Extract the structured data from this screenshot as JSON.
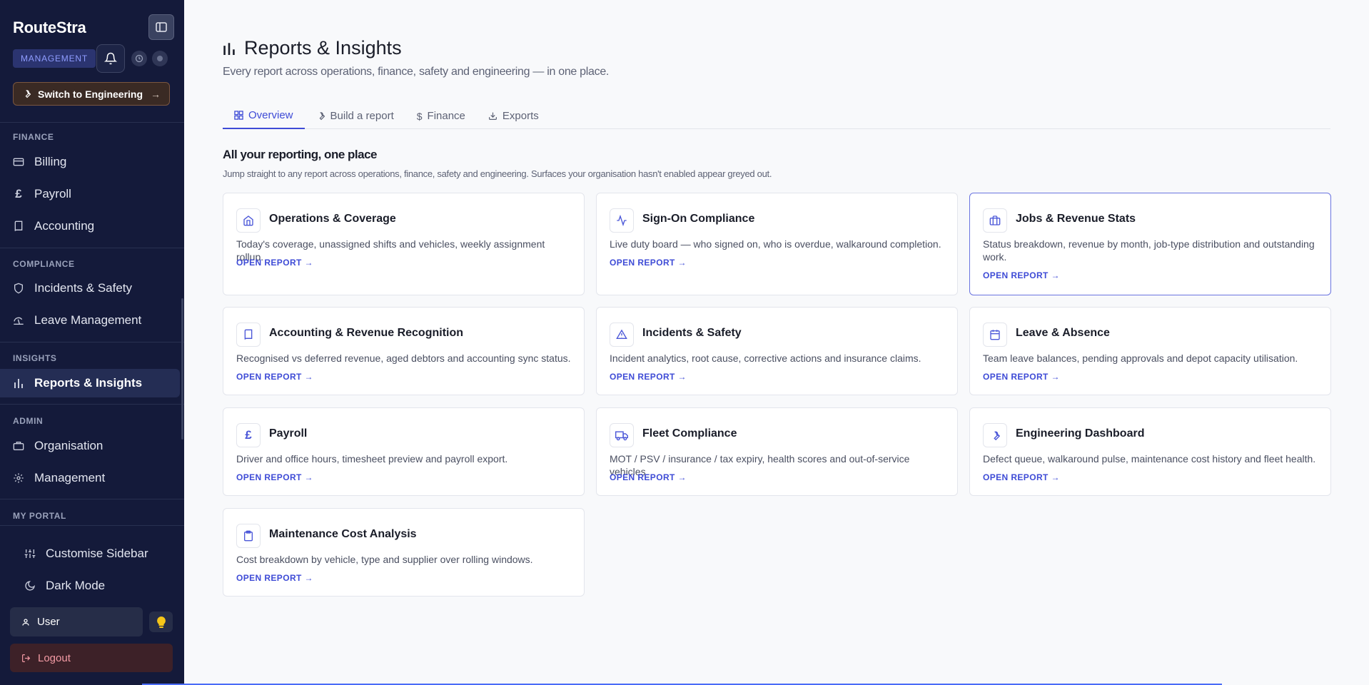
{
  "sidebar": {
    "brand": "RouteStra",
    "badge": "MANAGEMENT",
    "switch_label": "Switch to Engineering",
    "sections": {
      "finance": "FINANCE",
      "compliance": "COMPLIANCE",
      "insights": "INSIGHTS",
      "admin": "ADMIN",
      "my_portal": "MY PORTAL"
    },
    "items": {
      "billing": "Billing",
      "payroll": "Payroll",
      "accounting": "Accounting",
      "incidents": "Incidents & Safety",
      "leave": "Leave Management",
      "reports": "Reports & Insights",
      "organisation": "Organisation",
      "management": "Management"
    },
    "customise": "Customise Sidebar",
    "dark_mode": "Dark Mode",
    "user": "User",
    "logout": "Logout"
  },
  "header": {
    "title": "Reports & Insights",
    "subtitle": "Every report across operations, finance, safety and engineering — in one place."
  },
  "tabs": [
    "Overview",
    "Build a report",
    "Finance",
    "Exports"
  ],
  "section": {
    "title": "All your reporting, one place",
    "description": "Jump straight to any report across operations, finance, safety and engineering. Surfaces your organisation hasn't enabled appear greyed out."
  },
  "open_report_label": "OPEN REPORT →",
  "cards": [
    {
      "title": "Operations & Coverage",
      "desc": "Today's coverage, unassigned shifts and vehicles, weekly assignment rollup.",
      "icon": "home-icon"
    },
    {
      "title": "Sign-On Compliance",
      "desc": "Live duty board — who signed on, who is overdue, walkaround completion.",
      "icon": "activity-icon"
    },
    {
      "title": "Jobs & Revenue Stats",
      "desc": "Status breakdown, revenue by month, job-type distribution and outstanding work.",
      "icon": "briefcase-icon"
    },
    {
      "title": "Accounting & Revenue Recognition",
      "desc": "Recognised vs deferred revenue, aged debtors and accounting sync status.",
      "icon": "book-icon"
    },
    {
      "title": "Incidents & Safety",
      "desc": "Incident analytics, root cause, corrective actions and insurance claims.",
      "icon": "warning-icon"
    },
    {
      "title": "Leave & Absence",
      "desc": "Team leave balances, pending approvals and depot capacity utilisation.",
      "icon": "calendar-icon"
    },
    {
      "title": "Payroll",
      "desc": "Driver and office hours, timesheet preview and payroll export.",
      "icon": "pound-icon"
    },
    {
      "title": "Fleet Compliance",
      "desc": "MOT / PSV / insurance / tax expiry, health scores and out-of-service vehicles.",
      "icon": "truck-icon"
    },
    {
      "title": "Engineering Dashboard",
      "desc": "Defect queue, walkaround pulse, maintenance cost history and fleet health.",
      "icon": "wrench-icon"
    },
    {
      "title": "Maintenance Cost Analysis",
      "desc": "Cost breakdown by vehicle, type and supplier over rolling windows.",
      "icon": "clipboard-icon"
    }
  ]
}
